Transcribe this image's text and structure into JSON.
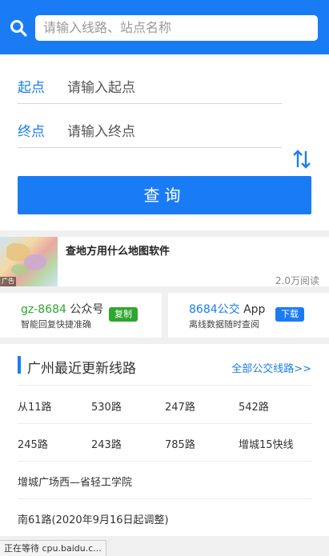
{
  "search": {
    "placeholder": "请输入线路、站点名称"
  },
  "route": {
    "start_label": "起点",
    "start_placeholder": "请输入起点",
    "end_label": "终点",
    "end_placeholder": "请输入终点",
    "query_label": "查询"
  },
  "ad": {
    "title": "查地方用什么地图软件",
    "reads": "2.0万阅读",
    "tag": "广告"
  },
  "promos": {
    "left": {
      "name_accent": "gz-8684",
      "name_rest": " 公众号",
      "desc": "智能回复快捷准确",
      "button": "复制"
    },
    "right": {
      "name_accent": "8684公交",
      "name_rest": " App",
      "desc": "离线数据随时查阅",
      "button": "下载"
    }
  },
  "lines": {
    "title": "广州最近更新线路",
    "all_link": "全部公交线路>>",
    "items": [
      "从11路",
      "530路",
      "247路",
      "542路",
      "245路",
      "243路",
      "785路",
      "增城15快线",
      "增城广场西—省轻工学院",
      "南61路(2020年9月16日起调整)"
    ]
  },
  "status_bar": "正在等待 cpu.baidu.c...",
  "colors": {
    "accent": "#1a7cf5",
    "green": "#2fa62f"
  }
}
